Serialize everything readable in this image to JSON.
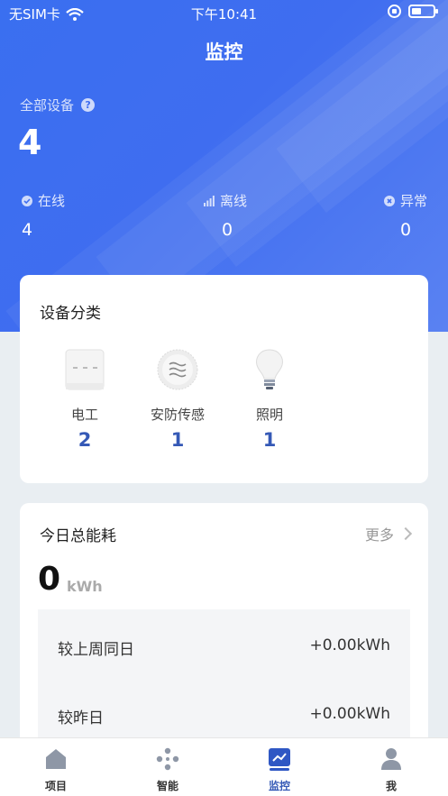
{
  "status_bar": {
    "carrier": "无SIM卡",
    "time": "下午10:41"
  },
  "header": {
    "title": "监控"
  },
  "summary": {
    "total_label": "全部设备",
    "total_value": "4",
    "online_label": "在线",
    "online_value": "4",
    "offline_label": "离线",
    "offline_value": "0",
    "abnormal_label": "异常",
    "abnormal_value": "0"
  },
  "category": {
    "title": "设备分类",
    "items": [
      {
        "name": "电工",
        "count": "2",
        "icon": "electrical-switch-icon"
      },
      {
        "name": "安防传感",
        "count": "1",
        "icon": "security-sensor-icon"
      },
      {
        "name": "照明",
        "count": "1",
        "icon": "light-bulb-icon"
      }
    ]
  },
  "energy": {
    "title": "今日总能耗",
    "more_label": "更多",
    "value": "0",
    "unit": "kWh",
    "compare": [
      {
        "label": "较上周同日",
        "value": "+0.00kWh"
      },
      {
        "label": "较昨日",
        "value": "+0.00kWh"
      }
    ]
  },
  "tabs": [
    {
      "label": "项目",
      "icon": "home-icon"
    },
    {
      "label": "智能",
      "icon": "smart-dots-icon"
    },
    {
      "label": "监控",
      "icon": "chart-monitor-icon"
    },
    {
      "label": "我",
      "icon": "person-icon"
    }
  ],
  "colors": {
    "primary": "#3f6df0",
    "accent_text": "#3559b6",
    "background": "#e9eef2"
  }
}
